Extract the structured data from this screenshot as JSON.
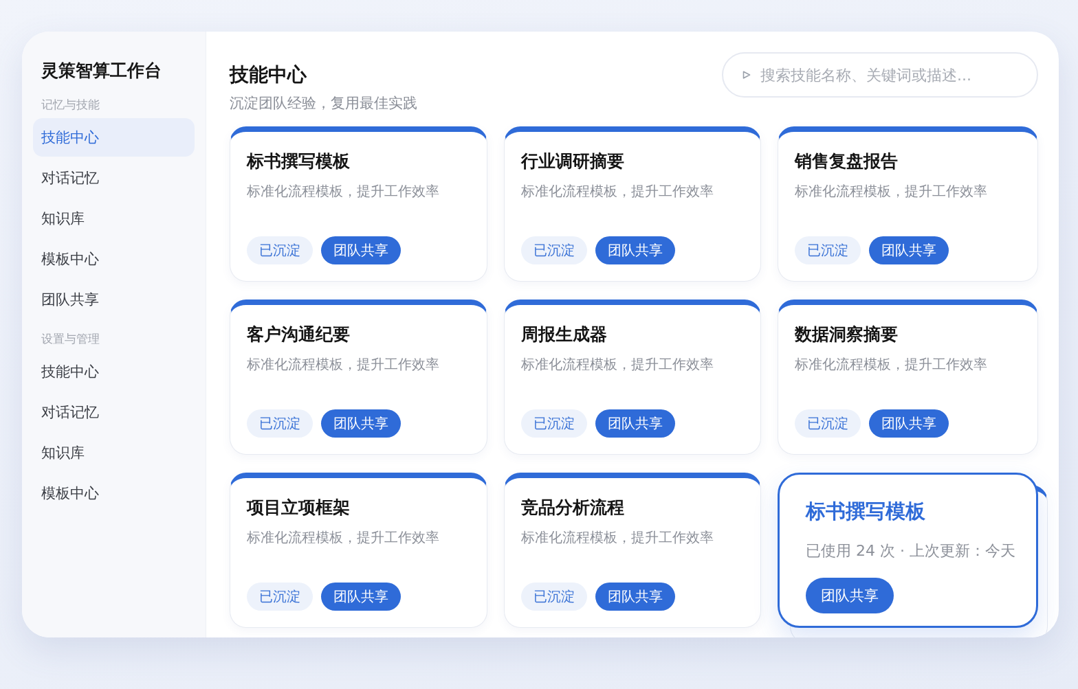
{
  "sidebar": {
    "title": "灵策智算工作台",
    "sections": [
      {
        "heading": "记忆与技能",
        "items": [
          {
            "label": "技能中心",
            "selected": true
          },
          {
            "label": "对话记忆",
            "selected": false
          },
          {
            "label": "知识库",
            "selected": false
          },
          {
            "label": "模板中心",
            "selected": false
          },
          {
            "label": "团队共享",
            "selected": false
          }
        ]
      },
      {
        "heading": "设置与管理",
        "items": [
          {
            "label": "技能中心",
            "selected": false
          },
          {
            "label": "对话记忆",
            "selected": false
          },
          {
            "label": "知识库",
            "selected": false
          },
          {
            "label": "模板中心",
            "selected": false
          }
        ]
      }
    ]
  },
  "header": {
    "title": "技能中心",
    "subtitle": "沉淀团队经验，复用最佳实践"
  },
  "search": {
    "placeholder": "搜索技能名称、关键词或描述..."
  },
  "cards": [
    {
      "kind": "skill",
      "title": "标书撰写模板",
      "description": "标准化流程模板，提升工作效率",
      "tags": [
        {
          "kind": "status",
          "label": "已沉淀"
        },
        {
          "kind": "share",
          "label": "团队共享"
        }
      ]
    },
    {
      "kind": "skill",
      "title": "行业调研摘要",
      "description": "标准化流程模板，提升工作效率",
      "tags": [
        {
          "kind": "status",
          "label": "已沉淀"
        },
        {
          "kind": "share",
          "label": "团队共享"
        }
      ]
    },
    {
      "kind": "skill",
      "title": "销售复盘报告",
      "description": "标准化流程模板，提升工作效率",
      "tags": [
        {
          "kind": "status",
          "label": "已沉淀"
        },
        {
          "kind": "share",
          "label": "团队共享"
        }
      ]
    },
    {
      "kind": "skill",
      "title": "客户沟通纪要",
      "description": "标准化流程模板，提升工作效率",
      "tags": [
        {
          "kind": "status",
          "label": "已沉淀"
        },
        {
          "kind": "share",
          "label": "团队共享"
        }
      ]
    },
    {
      "kind": "skill",
      "title": "周报生成器",
      "description": "标准化流程模板，提升工作效率",
      "tags": [
        {
          "kind": "status",
          "label": "已沉淀"
        },
        {
          "kind": "share",
          "label": "团队共享"
        }
      ]
    },
    {
      "kind": "skill",
      "title": "数据洞察摘要",
      "description": "标准化流程模板，提升工作效率",
      "tags": [
        {
          "kind": "status",
          "label": "已沉淀"
        },
        {
          "kind": "share",
          "label": "团队共享"
        }
      ]
    },
    {
      "kind": "skill",
      "title": "项目立项框架",
      "description": "标准化流程模板，提升工作效率",
      "tags": [
        {
          "kind": "status",
          "label": "已沉淀"
        },
        {
          "kind": "share",
          "label": "团队共享"
        }
      ]
    },
    {
      "kind": "skill",
      "title": "竞品分析流程",
      "description": "标准化流程模板，提升工作效率",
      "tags": [
        {
          "kind": "status",
          "label": "已沉淀"
        },
        {
          "kind": "share",
          "label": "团队共享"
        }
      ]
    },
    {
      "kind": "hover",
      "title": "标书撰写模板",
      "description": "已使用 24 次 · 上次更新：今天",
      "tags": [
        {
          "kind": "share",
          "label": "团队共享"
        }
      ]
    }
  ]
}
